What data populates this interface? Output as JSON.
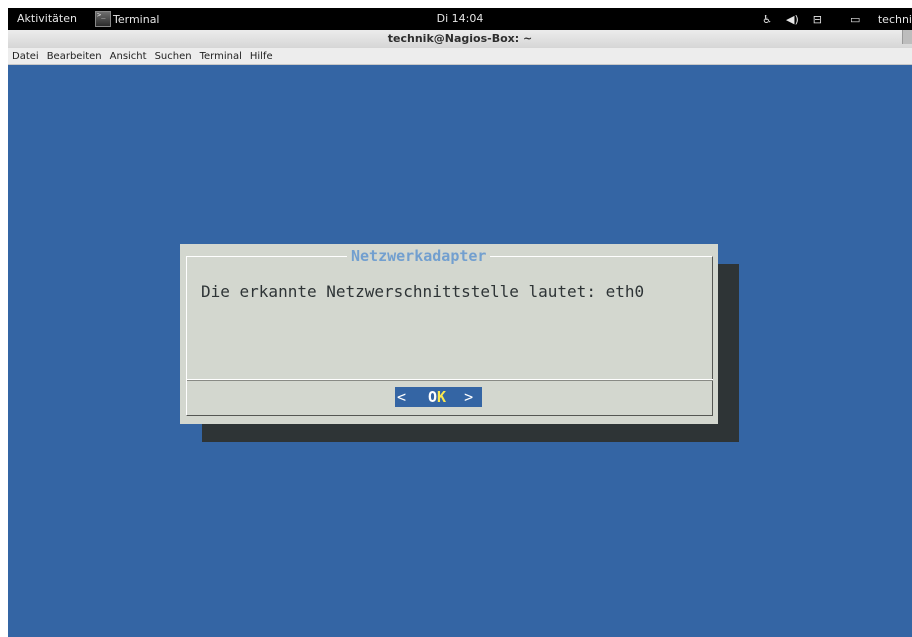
{
  "topbar": {
    "activities": "Aktivitäten",
    "app_name": "Terminal",
    "clock": "Di 14:04",
    "user": "techni"
  },
  "window": {
    "title": "technik@Nagios-Box: ~"
  },
  "menubar": {
    "items": [
      "Datei",
      "Bearbeiten",
      "Ansicht",
      "Suchen",
      "Terminal",
      "Hilfe"
    ]
  },
  "dialog": {
    "title": "Netzwerkadapter",
    "message": "Die erkannte Netzwerschnittstelle lautet: eth0",
    "button": {
      "left": "<",
      "label_first": "O",
      "label_hotkey": "K",
      "right": ">"
    }
  },
  "colors": {
    "terminal_bg": "#3465a4",
    "dialog_bg": "#d3d7cf",
    "dialog_title": "#729fcf",
    "hotkey": "#fce94f"
  },
  "icons": {
    "app_icon": "terminal-icon",
    "tray": [
      "accessibility-icon",
      "volume-icon",
      "network-icon",
      "user-status-icon"
    ]
  }
}
